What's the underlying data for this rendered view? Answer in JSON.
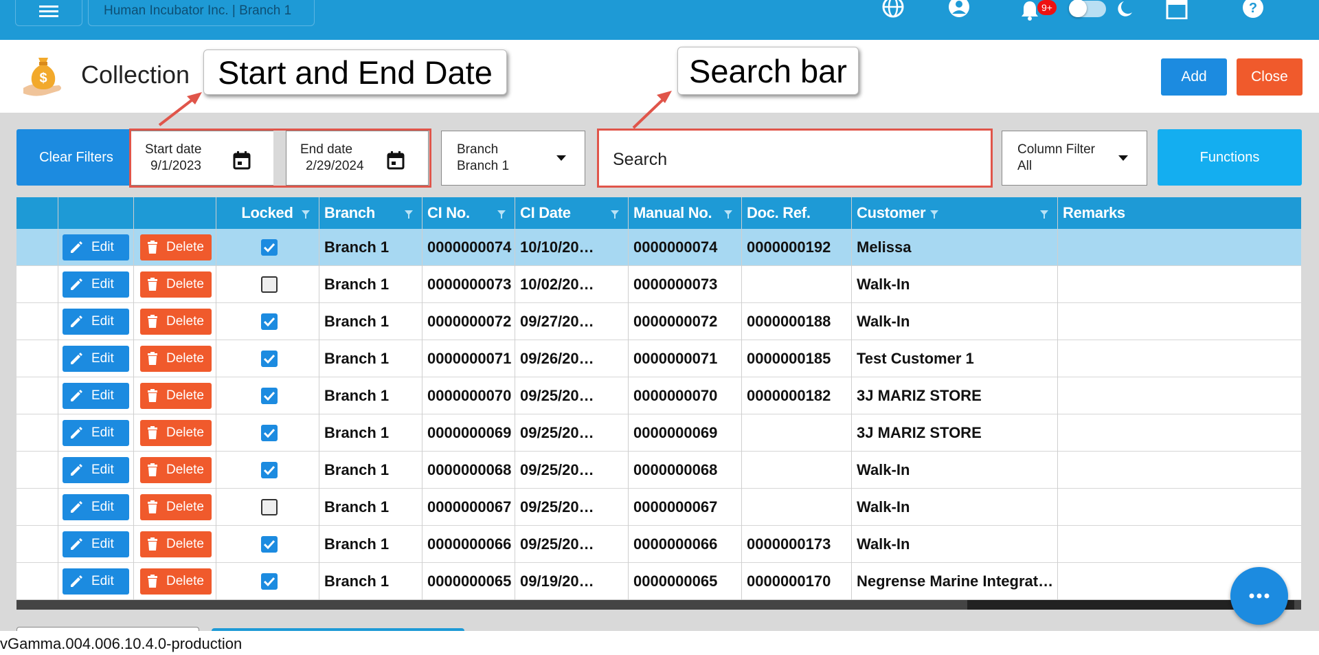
{
  "topbar": {
    "company": "Human Incubator Inc. | Branch 1",
    "notification_badge": "9+"
  },
  "header": {
    "title": "Collection",
    "add_label": "Add",
    "close_label": "Close"
  },
  "callouts": {
    "date": "Start and End Date",
    "search": "Search bar"
  },
  "filters": {
    "clear_label": "Clear Filters",
    "start_label": "Start date",
    "start_value": "9/1/2023",
    "end_label": "End date",
    "end_value": "2/29/2024",
    "branch_label": "Branch",
    "branch_value": "Branch 1",
    "search_placeholder": "Search",
    "column_filter_label": "Column Filter",
    "column_filter_value": "All",
    "functions_label": "Functions"
  },
  "table": {
    "columns": [
      "Locked",
      "Branch",
      "CI No.",
      "CI Date",
      "Manual No.",
      "Doc. Ref.",
      "Customer",
      "Remarks"
    ],
    "edit_label": "Edit",
    "delete_label": "Delete",
    "rows": [
      {
        "locked": true,
        "branch": "Branch 1",
        "ci_no": "0000000074",
        "ci_date": "10/10/20…",
        "manual_no": "0000000074",
        "doc_ref": "0000000192",
        "customer": "Melissa",
        "remarks": ""
      },
      {
        "locked": false,
        "branch": "Branch 1",
        "ci_no": "0000000073",
        "ci_date": "10/02/20…",
        "manual_no": "0000000073",
        "doc_ref": "",
        "customer": "Walk-In",
        "remarks": ""
      },
      {
        "locked": true,
        "branch": "Branch 1",
        "ci_no": "0000000072",
        "ci_date": "09/27/20…",
        "manual_no": "0000000072",
        "doc_ref": "0000000188",
        "customer": "Walk-In",
        "remarks": ""
      },
      {
        "locked": true,
        "branch": "Branch 1",
        "ci_no": "0000000071",
        "ci_date": "09/26/20…",
        "manual_no": "0000000071",
        "doc_ref": "0000000185",
        "customer": "Test Customer 1",
        "remarks": ""
      },
      {
        "locked": true,
        "branch": "Branch 1",
        "ci_no": "0000000070",
        "ci_date": "09/25/20…",
        "manual_no": "0000000070",
        "doc_ref": "0000000182",
        "customer": "3J MARIZ STORE",
        "remarks": ""
      },
      {
        "locked": true,
        "branch": "Branch 1",
        "ci_no": "0000000069",
        "ci_date": "09/25/20…",
        "manual_no": "0000000069",
        "doc_ref": "",
        "customer": "3J MARIZ STORE",
        "remarks": ""
      },
      {
        "locked": true,
        "branch": "Branch 1",
        "ci_no": "0000000068",
        "ci_date": "09/25/20…",
        "manual_no": "0000000068",
        "doc_ref": "",
        "customer": "Walk-In",
        "remarks": ""
      },
      {
        "locked": false,
        "branch": "Branch 1",
        "ci_no": "0000000067",
        "ci_date": "09/25/20…",
        "manual_no": "0000000067",
        "doc_ref": "",
        "customer": "Walk-In",
        "remarks": ""
      },
      {
        "locked": true,
        "branch": "Branch 1",
        "ci_no": "0000000066",
        "ci_date": "09/25/20…",
        "manual_no": "0000000066",
        "doc_ref": "0000000173",
        "customer": "Walk-In",
        "remarks": ""
      },
      {
        "locked": true,
        "branch": "Branch 1",
        "ci_no": "0000000065",
        "ci_date": "09/19/20…",
        "manual_no": "0000000065",
        "doc_ref": "0000000170",
        "customer": "Negrense Marine Integrat…",
        "remarks": ""
      }
    ]
  },
  "footer": {
    "version": "vGamma.004.006.10.4.0-production"
  },
  "colors": {
    "primary": "#1e9ad6",
    "button_blue": "#1c8be0",
    "button_orange": "#f05a2c",
    "selected_row": "#a7d8f2",
    "callout_border": "#e0554a"
  }
}
